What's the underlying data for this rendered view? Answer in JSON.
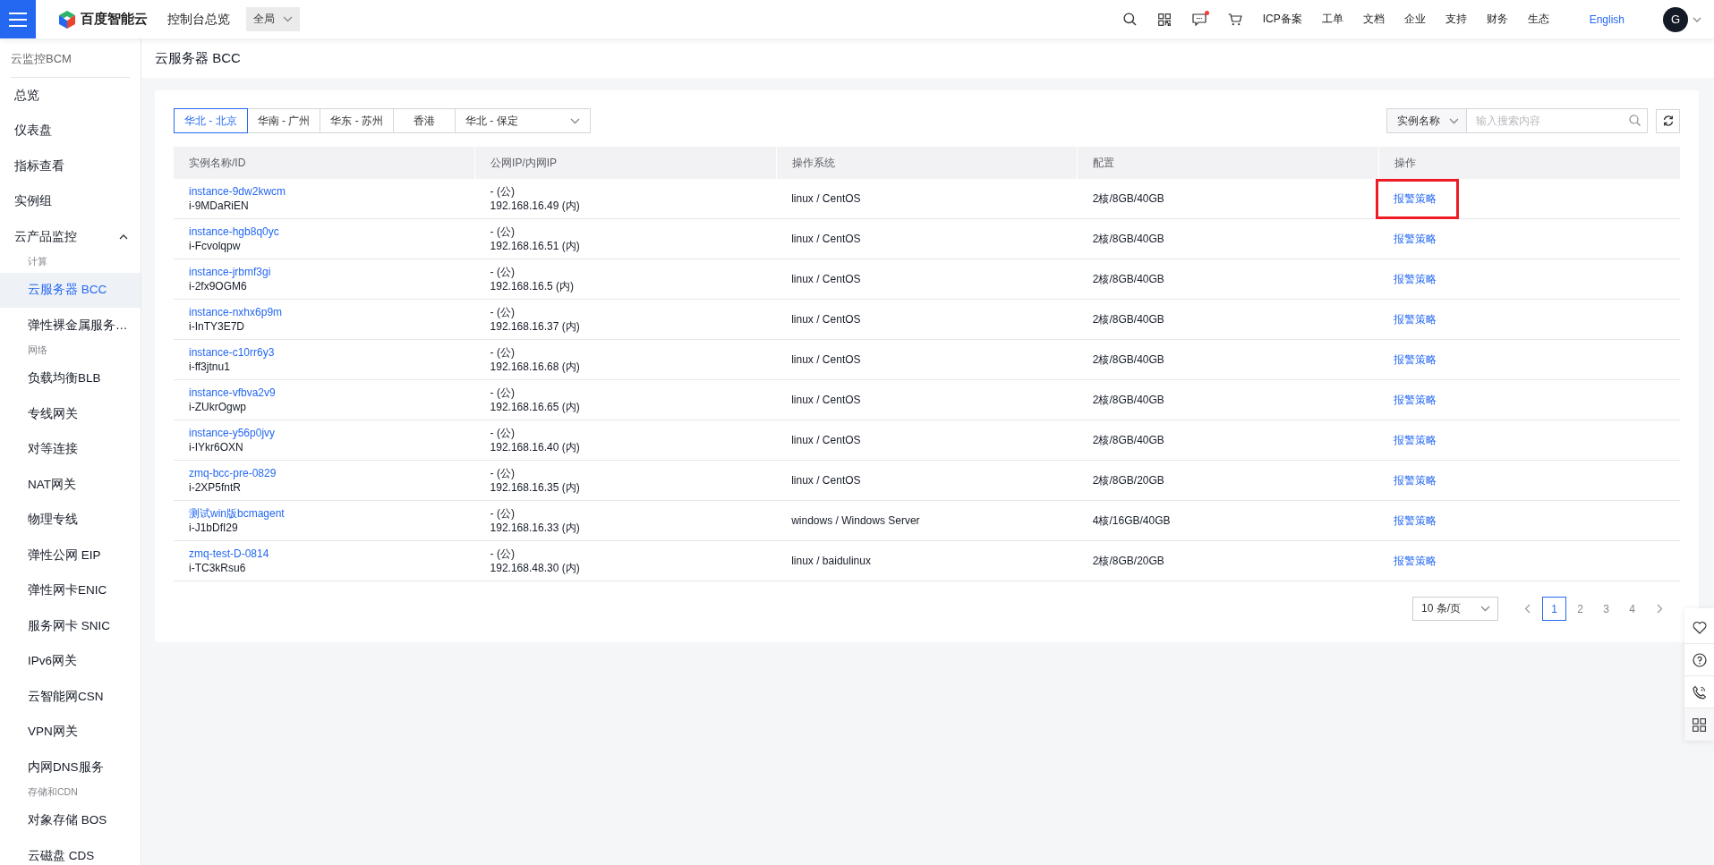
{
  "header": {
    "logo_text": "百度智能云",
    "console_link": "控制台总览",
    "scope_select": "全局",
    "message_unread": true,
    "links": [
      "ICP备案",
      "工单",
      "文档",
      "企业",
      "支持",
      "财务",
      "生态"
    ],
    "language": "English",
    "avatar": "G"
  },
  "sidebar": {
    "title": "云监控BCM",
    "items": [
      {
        "kind": "item",
        "label": "总览",
        "selected": false
      },
      {
        "kind": "item",
        "label": "仪表盘",
        "selected": false
      },
      {
        "kind": "item",
        "label": "指标查看",
        "selected": false
      },
      {
        "kind": "item",
        "label": "实例组",
        "selected": false
      },
      {
        "kind": "group",
        "label": "云产品监控",
        "expanded": true
      },
      {
        "kind": "section",
        "label": "计算"
      },
      {
        "kind": "subitem",
        "label": "云服务器 BCC",
        "selected": true
      },
      {
        "kind": "subitem",
        "label": "弹性裸金属服务…",
        "selected": false
      },
      {
        "kind": "section",
        "label": "网络"
      },
      {
        "kind": "subitem",
        "label": "负载均衡BLB",
        "selected": false
      },
      {
        "kind": "subitem",
        "label": "专线网关",
        "selected": false
      },
      {
        "kind": "subitem",
        "label": "对等连接",
        "selected": false
      },
      {
        "kind": "subitem",
        "label": "NAT网关",
        "selected": false
      },
      {
        "kind": "subitem",
        "label": "物理专线",
        "selected": false
      },
      {
        "kind": "subitem",
        "label": "弹性公网 EIP",
        "selected": false
      },
      {
        "kind": "subitem",
        "label": "弹性网卡ENIC",
        "selected": false
      },
      {
        "kind": "subitem",
        "label": "服务网卡 SNIC",
        "selected": false
      },
      {
        "kind": "subitem",
        "label": "IPv6网关",
        "selected": false
      },
      {
        "kind": "subitem",
        "label": "云智能网CSN",
        "selected": false
      },
      {
        "kind": "subitem",
        "label": "VPN网关",
        "selected": false
      },
      {
        "kind": "subitem",
        "label": "内网DNS服务",
        "selected": false
      },
      {
        "kind": "section",
        "label": "存储和CDN"
      },
      {
        "kind": "subitem",
        "label": "对象存储 BOS",
        "selected": false
      },
      {
        "kind": "subitem",
        "label": "云磁盘 CDS",
        "selected": false
      }
    ]
  },
  "page_title": "云服务器 BCC",
  "regions": [
    {
      "kind": "tab",
      "label": "华北 - 北京",
      "selected": true
    },
    {
      "kind": "tab",
      "label": "华南 - 广州",
      "selected": false
    },
    {
      "kind": "tab",
      "label": "华东 - 苏州",
      "selected": false
    },
    {
      "kind": "tab",
      "label": "香港",
      "selected": false
    },
    {
      "kind": "dropdown",
      "label": "华北 - 保定",
      "selected": false
    }
  ],
  "search": {
    "field_select": "实例名称",
    "placeholder": "输入搜索内容"
  },
  "table": {
    "columns": [
      "实例名称/ID",
      "公网IP/内网IP",
      "操作系统",
      "配置",
      "操作"
    ],
    "rows": [
      {
        "name": "instance-9dw2kwcm",
        "id": "i-9MDaRiEN",
        "public_ip": "- (公)",
        "private_ip": "192.168.16.49 (内)",
        "os": "linux / CentOS",
        "config": "2核/8GB/40GB",
        "action": "报警策略",
        "highlighted": true
      },
      {
        "name": "instance-hgb8q0yc",
        "id": "i-Fcvolqpw",
        "public_ip": "- (公)",
        "private_ip": "192.168.16.51 (内)",
        "os": "linux / CentOS",
        "config": "2核/8GB/40GB",
        "action": "报警策略",
        "highlighted": false
      },
      {
        "name": "instance-jrbmf3gi",
        "id": "i-2fx9OGM6",
        "public_ip": "- (公)",
        "private_ip": "192.168.16.5 (内)",
        "os": "linux / CentOS",
        "config": "2核/8GB/40GB",
        "action": "报警策略",
        "highlighted": false
      },
      {
        "name": "instance-nxhx6p9m",
        "id": "i-InTY3E7D",
        "public_ip": "- (公)",
        "private_ip": "192.168.16.37 (内)",
        "os": "linux / CentOS",
        "config": "2核/8GB/40GB",
        "action": "报警策略",
        "highlighted": false
      },
      {
        "name": "instance-c10rr6y3",
        "id": "i-ff3jtnu1",
        "public_ip": "- (公)",
        "private_ip": "192.168.16.68 (内)",
        "os": "linux / CentOS",
        "config": "2核/8GB/40GB",
        "action": "报警策略",
        "highlighted": false
      },
      {
        "name": "instance-vfbva2v9",
        "id": "i-ZUkrOgwp",
        "public_ip": "- (公)",
        "private_ip": "192.168.16.65 (内)",
        "os": "linux / CentOS",
        "config": "2核/8GB/40GB",
        "action": "报警策略",
        "highlighted": false
      },
      {
        "name": "instance-y56p0jvy",
        "id": "i-IYkr6OXN",
        "public_ip": "- (公)",
        "private_ip": "192.168.16.40 (内)",
        "os": "linux / CentOS",
        "config": "2核/8GB/40GB",
        "action": "报警策略",
        "highlighted": false
      },
      {
        "name": "zmq-bcc-pre-0829",
        "id": "i-2XP5fntR",
        "public_ip": "- (公)",
        "private_ip": "192.168.16.35 (内)",
        "os": "linux / CentOS",
        "config": "2核/8GB/20GB",
        "action": "报警策略",
        "highlighted": false
      },
      {
        "name": "测试win版bcmagent",
        "id": "i-J1bDfI29",
        "public_ip": "- (公)",
        "private_ip": "192.168.16.33 (内)",
        "os": "windows / Windows Server",
        "config": "4核/16GB/40GB",
        "action": "报警策略",
        "highlighted": false
      },
      {
        "name": "zmq-test-D-0814",
        "id": "i-TC3kRsu6",
        "public_ip": "- (公)",
        "private_ip": "192.168.48.30 (内)",
        "os": "linux / baidulinux",
        "config": "2核/8GB/20GB",
        "action": "报警策略",
        "highlighted": false
      }
    ]
  },
  "pagination": {
    "page_size": "10 条/页",
    "pages": [
      {
        "label": "1",
        "selected": true
      },
      {
        "label": "2",
        "selected": false
      },
      {
        "label": "3",
        "selected": false
      },
      {
        "label": "4",
        "selected": false
      }
    ]
  }
}
